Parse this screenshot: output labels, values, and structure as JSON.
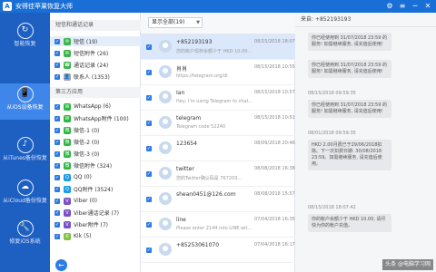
{
  "window": {
    "title": "安得佳苹果恢复大师",
    "logo_glyph": "A",
    "controls": [
      "⚙",
      "≡",
      "─",
      "✕"
    ]
  },
  "nav": {
    "items": [
      {
        "icon": "↻",
        "label": "智能恢复"
      },
      {
        "icon": "📱",
        "label": "从iOS设备恢复"
      },
      {
        "icon": "♪",
        "label": "从iTunes备份恢复"
      },
      {
        "icon": "☁",
        "label": "从iCloud备份恢复"
      },
      {
        "icon": "🔧",
        "label": "修复iOS系统"
      }
    ]
  },
  "categories": {
    "section1_title": "短信和通话记录",
    "section1": [
      {
        "label": "短信 (19)",
        "color": "#3ab54a",
        "glyph": "✉"
      },
      {
        "label": "短信附件 (26)",
        "color": "#3ab54a",
        "glyph": "✉"
      },
      {
        "label": "通话记录 (24)",
        "color": "#3ab54a",
        "glyph": "☎"
      },
      {
        "label": "联系人 (1353)",
        "color": "#9aa4b0",
        "glyph": "👤"
      }
    ],
    "section2_title": "第三方应用",
    "section2": [
      {
        "label": "WhatsApp (6)",
        "color": "#2bb741",
        "glyph": "W"
      },
      {
        "label": "WhatsApp附件 (100)",
        "color": "#2bb741",
        "glyph": "W"
      },
      {
        "label": "微信-1 (0)",
        "color": "#2bb741",
        "glyph": "微"
      },
      {
        "label": "微信-2 (0)",
        "color": "#2bb741",
        "glyph": "微"
      },
      {
        "label": "微信-3 (0)",
        "color": "#2bb741",
        "glyph": "微"
      },
      {
        "label": "微信附件 (324)",
        "color": "#2bb741",
        "glyph": "微"
      },
      {
        "label": "QQ (0)",
        "color": "#1a9be8",
        "glyph": "Q"
      },
      {
        "label": "QQ附件 (3524)",
        "color": "#1a9be8",
        "glyph": "Q"
      },
      {
        "label": "Viber (0)",
        "color": "#7b51c7",
        "glyph": "V"
      },
      {
        "label": "Viber通话记录 (7)",
        "color": "#7b51c7",
        "glyph": "V"
      },
      {
        "label": "Viber附件 (7)",
        "color": "#7b51c7",
        "glyph": "V"
      },
      {
        "label": "Kik (5)",
        "color": "#80c342",
        "glyph": "K"
      }
    ],
    "back_glyph": "←"
  },
  "filter": {
    "selected": "显示全部(19)",
    "caret": "▼"
  },
  "messages": [
    {
      "name": "+852193193",
      "preview": "您的帐户现存余额少于 HKD 10.00...",
      "time": "08/15/2018 18:07"
    },
    {
      "name": "肖肖",
      "preview": "https://telegram.org/dl",
      "time": "08/15/2018 10:55"
    },
    {
      "name": "Ian",
      "preview": "Hey, I'm using Telegram to chat...",
      "time": "08/15/2018 10:57"
    },
    {
      "name": "telegram",
      "preview": "Telegram code 52240",
      "time": "08/15/2018 10:51"
    },
    {
      "name": "123654",
      "preview": "",
      "time": "08/09/2018 20:46"
    },
    {
      "name": "twitter",
      "preview": "您的Twitter确认码是 767203...",
      "time": "08/08/2018 16:38"
    },
    {
      "name": "shean0451@126.com",
      "preview": "",
      "time": "08/08/2018 15:57"
    },
    {
      "name": "line",
      "preview": "Please enter 2144 into LINE wit...",
      "time": "07/04/2018 16:35"
    },
    {
      "name": "+85253061070",
      "preview": "",
      "time": "07/04/2018 16:17"
    }
  ],
  "conversation": {
    "header": "来自:  +852193193",
    "bubbles": [
      "你已经使用到 31/07/2018 23:59 的服务! 如需继续服务, 请充值后使用!",
      "你已经使用到 31/07/2018 23:59 的服务! 如需继续服务, 请充值后使用!",
      "你已经使用到 31/07/2018 23:59 的服务! 如需继续服务, 请充值后使用!",
      "HKD 2.00月费已于29/06/2018扣除。下一次扣费日期: 30/08/2018 23:59。如需继续服务, 请充值后使用。",
      "你的帐户余额少于 HKD 10.00, 请尽快为你的帐户充值。"
    ],
    "stamps": [
      "08/15/2018 09:59:35",
      "08/01/2018 09:59:35",
      "08/15/2018 18:07:42"
    ]
  },
  "watermark": "头条 @电脑学习网"
}
